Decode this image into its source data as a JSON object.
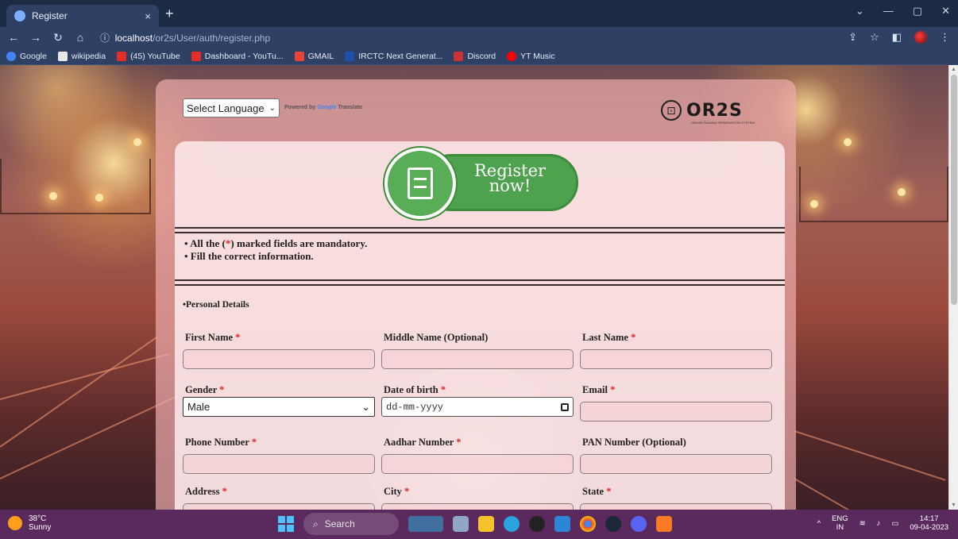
{
  "browser": {
    "tab_title": "Register",
    "tab_close": "×",
    "new_tab": "+",
    "url_host": "localhost",
    "url_path": "/or2s/User/auth/register.php",
    "bookmarks": [
      "Google",
      "wikipedia",
      "(45) YouTube",
      "Dashboard - YouTu...",
      "GMAIL",
      "IRCTC Next Generat...",
      "Discord",
      "YT Music"
    ]
  },
  "page": {
    "language_select": "Select Language",
    "powered_by": "Powered by",
    "google": "Google",
    "translate": "Translate",
    "logo_text": "OR2S",
    "logo_subtitle": "ONLINE RAILWAY RESERVATION SYSTEM",
    "badge_line1": "Register",
    "badge_line2": "now!",
    "notes": {
      "line1_pre": "• All the (",
      "line1_req": "*",
      "line1_post": ") marked fields are mandatory.",
      "line2": "• Fill the correct information."
    },
    "section_title": "•Personal Details",
    "fields": {
      "first_name": "First Name",
      "middle_name": "Middle Name (Optional)",
      "last_name": "Last Name",
      "gender": "Gender",
      "gender_value": "Male",
      "dob": "Date of birth",
      "dob_placeholder": "dd-mm-yyyy",
      "email": "Email",
      "phone": "Phone Number",
      "aadhar": "Aadhar Number",
      "pan": "PAN Number (Optional)",
      "address": "Address",
      "city": "City",
      "state": "State"
    },
    "required_mark": "*"
  },
  "taskbar": {
    "temp": "38°C",
    "weather": "Sunny",
    "search": "Search",
    "lang1": "ENG",
    "lang2": "IN",
    "time": "14:17",
    "date": "09-04-2023"
  }
}
